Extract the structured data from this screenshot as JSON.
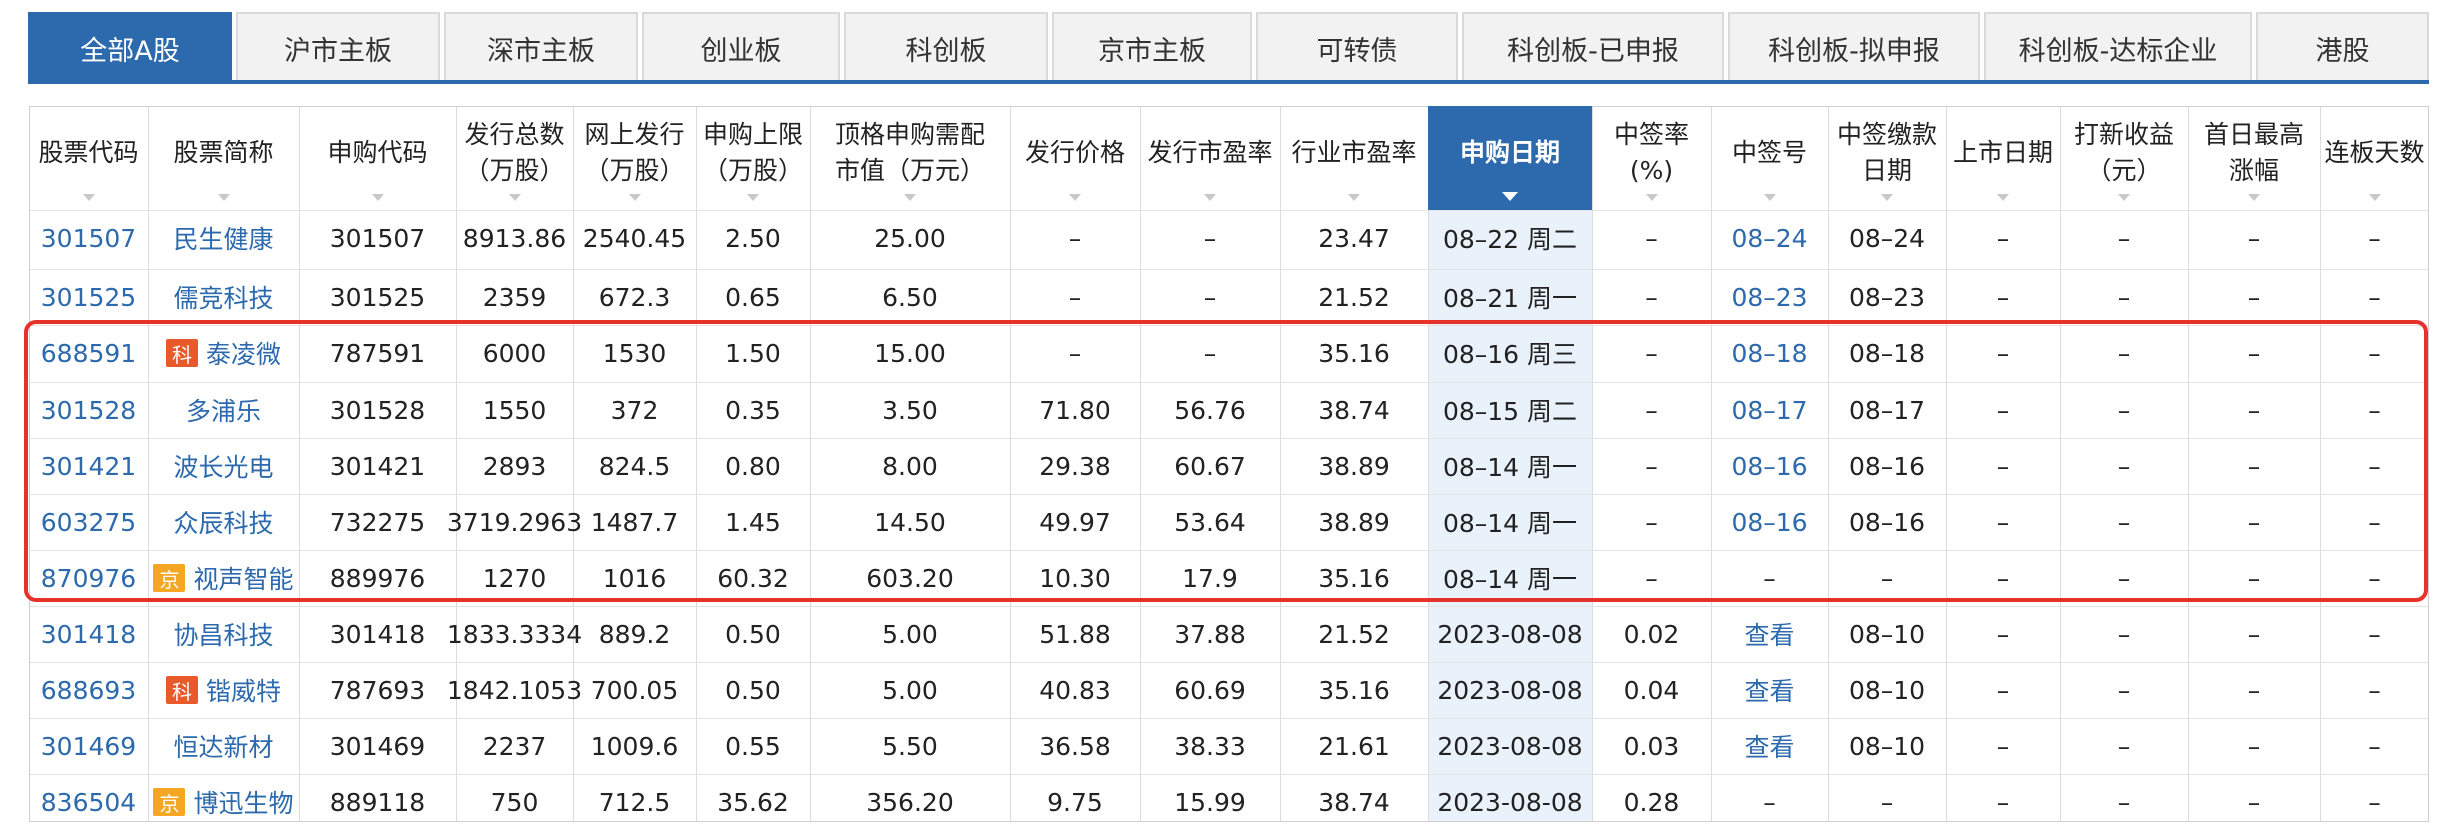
{
  "tabs": [
    {
      "label": "全部A股",
      "active": true
    },
    {
      "label": "沪市主板",
      "active": false
    },
    {
      "label": "深市主板",
      "active": false
    },
    {
      "label": "创业板",
      "active": false
    },
    {
      "label": "科创板",
      "active": false
    },
    {
      "label": "京市主板",
      "active": false
    },
    {
      "label": "可转债",
      "active": false
    },
    {
      "label": "科创板-已申报",
      "active": false
    },
    {
      "label": "科创板-拟申报",
      "active": false
    },
    {
      "label": "科创板-达标企业",
      "active": false
    },
    {
      "label": "港股",
      "active": false
    }
  ],
  "table": {
    "sorted_column": 9,
    "columns": [
      [
        "股票代码"
      ],
      [
        "股票简称"
      ],
      [
        "申购代码"
      ],
      [
        "发行总数",
        "（万股）"
      ],
      [
        "网上发行",
        "（万股）"
      ],
      [
        "申购上限",
        "（万股）"
      ],
      [
        "顶格申购需配",
        "市值（万元）"
      ],
      [
        "发行价格"
      ],
      [
        "发行市盈率"
      ],
      [
        "行业市盈率"
      ],
      [
        "申购日期"
      ],
      [
        "中签率",
        "(%)"
      ],
      [
        "中签号"
      ],
      [
        "中签缴款",
        "日期"
      ],
      [
        "上市日期"
      ],
      [
        "打新收益",
        "（元）"
      ],
      [
        "首日最高",
        "涨幅"
      ],
      [
        "连板天数"
      ]
    ],
    "rows": [
      {
        "code": "301507",
        "badge": "",
        "name": "民生健康",
        "sub_code": "301507",
        "total": "8913.86",
        "online": "2540.45",
        "limit": "2.50",
        "cap": "25.00",
        "price": "–",
        "pe": "–",
        "ind_pe": "23.47",
        "date": "08–22 周二",
        "rate": "–",
        "lot": "08–24",
        "lot_link": true,
        "pay": "08–24",
        "list": "–",
        "profit": "–",
        "rise": "–",
        "days": "–"
      },
      {
        "code": "301525",
        "badge": "",
        "name": "儒竞科技",
        "sub_code": "301525",
        "total": "2359",
        "online": "672.3",
        "limit": "0.65",
        "cap": "6.50",
        "price": "–",
        "pe": "–",
        "ind_pe": "21.52",
        "date": "08–21 周一",
        "rate": "–",
        "lot": "08–23",
        "lot_link": true,
        "pay": "08–23",
        "list": "–",
        "profit": "–",
        "rise": "–",
        "days": "–"
      },
      {
        "code": "688591",
        "badge": "科",
        "name": "泰凌微",
        "sub_code": "787591",
        "total": "6000",
        "online": "1530",
        "limit": "1.50",
        "cap": "15.00",
        "price": "–",
        "pe": "–",
        "ind_pe": "35.16",
        "date": "08–16 周三",
        "rate": "–",
        "lot": "08–18",
        "lot_link": true,
        "pay": "08–18",
        "list": "–",
        "profit": "–",
        "rise": "–",
        "days": "–"
      },
      {
        "code": "301528",
        "badge": "",
        "name": "多浦乐",
        "sub_code": "301528",
        "total": "1550",
        "online": "372",
        "limit": "0.35",
        "cap": "3.50",
        "price": "71.80",
        "pe": "56.76",
        "ind_pe": "38.74",
        "date": "08–15 周二",
        "rate": "–",
        "lot": "08–17",
        "lot_link": true,
        "pay": "08–17",
        "list": "–",
        "profit": "–",
        "rise": "–",
        "days": "–"
      },
      {
        "code": "301421",
        "badge": "",
        "name": "波长光电",
        "sub_code": "301421",
        "total": "2893",
        "online": "824.5",
        "limit": "0.80",
        "cap": "8.00",
        "price": "29.38",
        "pe": "60.67",
        "ind_pe": "38.89",
        "date": "08–14 周一",
        "rate": "–",
        "lot": "08–16",
        "lot_link": true,
        "pay": "08–16",
        "list": "–",
        "profit": "–",
        "rise": "–",
        "days": "–"
      },
      {
        "code": "603275",
        "badge": "",
        "name": "众辰科技",
        "sub_code": "732275",
        "total": "3719.2963",
        "online": "1487.7",
        "limit": "1.45",
        "cap": "14.50",
        "price": "49.97",
        "pe": "53.64",
        "ind_pe": "38.89",
        "date": "08–14 周一",
        "rate": "–",
        "lot": "08–16",
        "lot_link": true,
        "pay": "08–16",
        "list": "–",
        "profit": "–",
        "rise": "–",
        "days": "–"
      },
      {
        "code": "870976",
        "badge": "京",
        "name": "视声智能",
        "sub_code": "889976",
        "total": "1270",
        "online": "1016",
        "limit": "60.32",
        "cap": "603.20",
        "price": "10.30",
        "pe": "17.9",
        "ind_pe": "35.16",
        "date": "08–14 周一",
        "rate": "–",
        "lot": "–",
        "lot_link": false,
        "pay": "–",
        "list": "–",
        "profit": "–",
        "rise": "–",
        "days": "–"
      },
      {
        "code": "301418",
        "badge": "",
        "name": "协昌科技",
        "sub_code": "301418",
        "total": "1833.3334",
        "online": "889.2",
        "limit": "0.50",
        "cap": "5.00",
        "price": "51.88",
        "pe": "37.88",
        "ind_pe": "21.52",
        "date": "2023-08-08",
        "rate": "0.02",
        "lot": "查看",
        "lot_link": true,
        "pay": "08–10",
        "list": "–",
        "profit": "–",
        "rise": "–",
        "days": "–"
      },
      {
        "code": "688693",
        "badge": "科",
        "name": "锴威特",
        "sub_code": "787693",
        "total": "1842.1053",
        "online": "700.05",
        "limit": "0.50",
        "cap": "5.00",
        "price": "40.83",
        "pe": "60.69",
        "ind_pe": "35.16",
        "date": "2023-08-08",
        "rate": "0.04",
        "lot": "查看",
        "lot_link": true,
        "pay": "08–10",
        "list": "–",
        "profit": "–",
        "rise": "–",
        "days": "–"
      },
      {
        "code": "301469",
        "badge": "",
        "name": "恒达新材",
        "sub_code": "301469",
        "total": "2237",
        "online": "1009.6",
        "limit": "0.55",
        "cap": "5.50",
        "price": "36.58",
        "pe": "38.33",
        "ind_pe": "21.61",
        "date": "2023-08-08",
        "rate": "0.03",
        "lot": "查看",
        "lot_link": true,
        "pay": "08–10",
        "list": "–",
        "profit": "–",
        "rise": "–",
        "days": "–"
      },
      {
        "code": "836504",
        "badge": "京",
        "name": "博迅生物",
        "sub_code": "889118",
        "total": "750",
        "online": "712.5",
        "limit": "35.62",
        "cap": "356.20",
        "price": "9.75",
        "pe": "15.99",
        "ind_pe": "38.74",
        "date": "2023-08-08",
        "rate": "0.28",
        "lot": "–",
        "lot_link": false,
        "pay": "–",
        "list": "–",
        "profit": "–",
        "rise": "–",
        "days": "–"
      }
    ]
  }
}
